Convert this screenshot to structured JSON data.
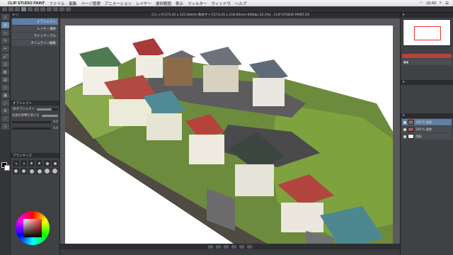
{
  "menubar": {
    "app_name": "CLIP STUDIO PAINT",
    "items": [
      "ファイル",
      "編集",
      "ページ管理",
      "アニメーション",
      "レイヤー",
      "選択範囲",
      "表示",
      "フィルター",
      "ウィンドウ",
      "ヘルプ"
    ],
    "clock": "15:43"
  },
  "document": {
    "title": "コミック(175.45 x 121.60mm 製本サイズ173.45 x 116.60mm 600dpi 32.1%) - CLIP STUDIO PAINT EX"
  },
  "tools": {
    "selected_tool_icon": "pen-icon",
    "sub_tools": [
      "オブジェクト",
      "レイヤー選択",
      "ライトテーブル",
      "タイムライン編集"
    ],
    "selected_index": 0
  },
  "tool_property": {
    "header": "オブジェクト",
    "rows": [
      {
        "label": "3Dオブジェクト",
        "value": 70
      },
      {
        "label": "光源の影響を受ける",
        "value": 100
      },
      {
        "label": "0.0",
        "value": 0
      },
      {
        "label": "0.0",
        "value": 0
      }
    ]
  },
  "brush_size": {
    "header": "ブラシサイズ"
  },
  "layers": {
    "rows": [
      {
        "name": "100 % 通常",
        "selected": true,
        "image_thumb": true
      },
      {
        "name": "100 % 通常",
        "selected": false,
        "image_thumb": true
      },
      {
        "name": "用紙",
        "selected": false,
        "image_thumb": false
      }
    ]
  },
  "colors": {
    "accent": "#5e7fa6",
    "panel": "#3f4145",
    "menubar": "#e8e8e8",
    "highlight_red": "#b6423c"
  }
}
